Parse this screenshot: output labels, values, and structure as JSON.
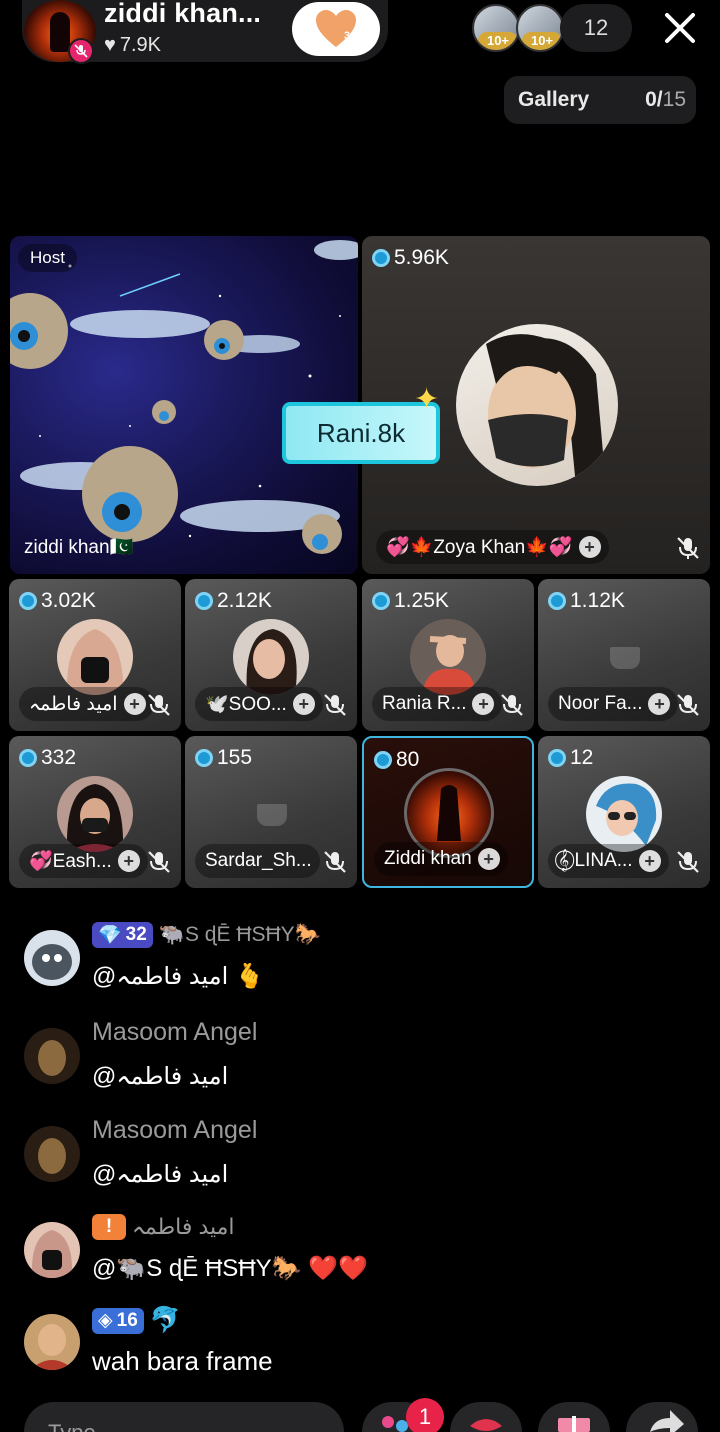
{
  "header": {
    "host_name": "ziddi khan...",
    "host_likes": "7.9K",
    "follow_count": "3",
    "viewer_badges": [
      "10+",
      "10+"
    ],
    "viewer_count": "12"
  },
  "gallery": {
    "label": "Gallery",
    "current": "0/",
    "max": "15"
  },
  "seats": {
    "host": {
      "tag": "Host",
      "name": "ziddi khan🇵🇰"
    },
    "guest": {
      "coins": "5.96K",
      "name": "💞🍁Zoya Khan🍁💞"
    },
    "sticker": "Rani.8k",
    "small": [
      {
        "coins": "3.02K",
        "name": "امید فاطمہ"
      },
      {
        "coins": "2.12K",
        "name": "🕊️SOO..."
      },
      {
        "coins": "1.25K",
        "name": "Rania R..."
      },
      {
        "coins": "1.12K",
        "name": "Noor Fa..."
      },
      {
        "coins": "332",
        "name": "💞Eash..."
      },
      {
        "coins": "155",
        "name": "Sardar_Sh..."
      },
      {
        "coins": "80",
        "name": "Ziddi khan"
      },
      {
        "coins": "12",
        "name": "𝄞⃝ LINA..."
      }
    ]
  },
  "chat": [
    {
      "level": "32",
      "username": "🐃S ɖĒ ĦSĦY🐎",
      "text": "@امید فاطمہ 🫰"
    },
    {
      "username": "Masoom Angel",
      "text": "@امید فاطمہ"
    },
    {
      "username": "Masoom Angel",
      "text": "@امید فاطمہ"
    },
    {
      "level": "!",
      "username": "امید فاطمہ",
      "text": "@🐃S ɖĒ ĦSĦY🐎 ❤️❤️"
    },
    {
      "level": "16",
      "username": "🐬",
      "text": "wah  bara frame"
    }
  ],
  "bottom": {
    "input_placeholder": "Type...",
    "notification_count": "1"
  },
  "colors": {
    "accent": "#1dc5dd",
    "badge": "#e8234a",
    "mic_off": "#e5266c"
  }
}
